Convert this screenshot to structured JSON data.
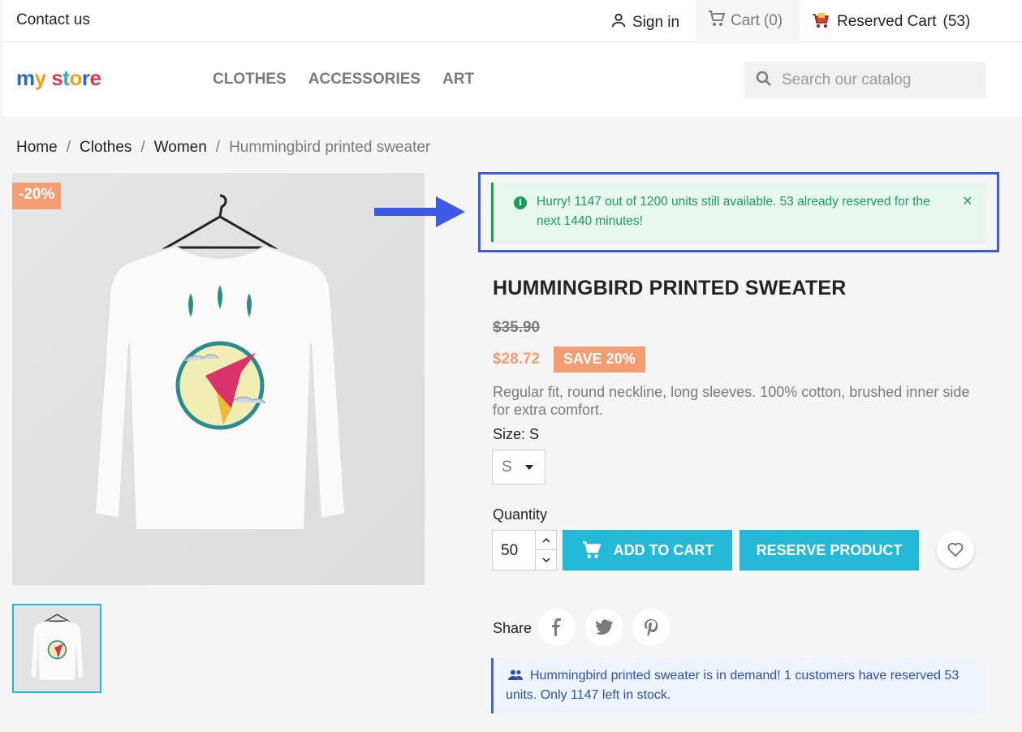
{
  "topbar": {
    "contact_label": "Contact us",
    "signin_label": "Sign in",
    "cart_label": "Cart",
    "cart_count": "(0)",
    "reserved_label": "Reserved Cart",
    "reserved_count": "(53)"
  },
  "header": {
    "logo_text": [
      "m",
      "y",
      " ",
      "s",
      "t",
      "o",
      "r",
      "e"
    ],
    "nav": [
      "CLOTHES",
      "ACCESSORIES",
      "ART"
    ],
    "search_placeholder": "Search our catalog"
  },
  "breadcrumb": [
    "Home",
    "Clothes",
    "Women",
    "Hummingbird printed sweater"
  ],
  "images": {
    "discount_flag": "-20%"
  },
  "alert": {
    "message": "Hurry! 1147 out of 1200 units still available. 53 already reserved for the next 1440 minutes!",
    "close_symbol": "×",
    "info_symbol": "i"
  },
  "product": {
    "title": "HUMMINGBIRD PRINTED SWEATER",
    "regular_price": "$35.90",
    "price": "$28.72",
    "save_badge": "SAVE 20%",
    "description": "Regular fit, round neckline, long sleeves. 100% cotton, brushed inner side for extra comfort.",
    "size_label": "Size: S",
    "size_value": "S",
    "quantity_label": "Quantity",
    "quantity_value": "50",
    "add_to_cart_label": "ADD TO CART",
    "reserve_label": "RESERVE PRODUCT",
    "share_label": "Share"
  },
  "demand_notice": {
    "message": "Hummingbird printed sweater is in demand! 1 customers have reserved 53 units. Only 1147 left in stock."
  },
  "colors": {
    "accent": "#24b9d7",
    "discount": "#f39d72",
    "success": "#1a9c5e",
    "info": "#2c4fb5",
    "highlight": "#3d5ae4"
  }
}
